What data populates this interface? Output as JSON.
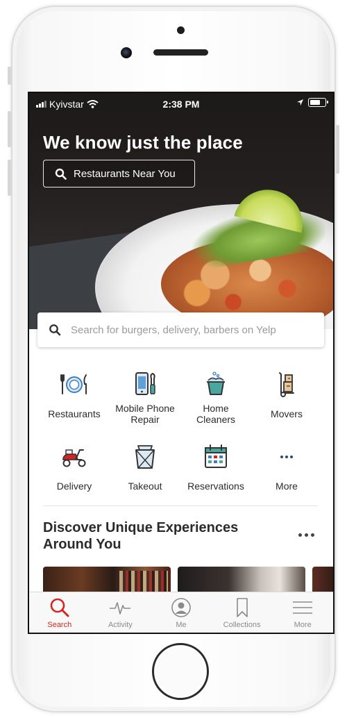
{
  "status_bar": {
    "carrier": "Kyivstar",
    "time": "2:38 PM"
  },
  "hero": {
    "title": "We know just the place",
    "near_button_label": "Restaurants Near You"
  },
  "search": {
    "placeholder": "Search for burgers, delivery, barbers on Yelp"
  },
  "categories": [
    {
      "label": "Restaurants",
      "icon": "plate-fork-knife-icon"
    },
    {
      "label": "Mobile Phone Repair",
      "line1": "Mobile Phone",
      "line2": "Repair",
      "icon": "phone-repair-icon"
    },
    {
      "label": "Home Cleaners",
      "line1": "Home",
      "line2": "Cleaners",
      "icon": "cleaning-bucket-icon"
    },
    {
      "label": "Movers",
      "icon": "hand-truck-icon"
    },
    {
      "label": "Delivery",
      "icon": "scooter-icon"
    },
    {
      "label": "Takeout",
      "icon": "takeout-bag-icon"
    },
    {
      "label": "Reservations",
      "icon": "calendar-icon"
    },
    {
      "label": "More",
      "icon": "more-dots-icon"
    }
  ],
  "discover": {
    "title_line1": "Discover Unique Experiences",
    "title_line2": "Around You"
  },
  "tabs": [
    {
      "label": "Search",
      "icon": "search-icon",
      "active": true
    },
    {
      "label": "Activity",
      "icon": "activity-icon"
    },
    {
      "label": "Me",
      "icon": "profile-icon"
    },
    {
      "label": "Collections",
      "icon": "bookmark-icon"
    },
    {
      "label": "More",
      "icon": "menu-icon"
    }
  ],
  "colors": {
    "accent": "#d32323",
    "icon_blue": "#3b7fc4",
    "icon_teal": "#4aa6a0"
  }
}
